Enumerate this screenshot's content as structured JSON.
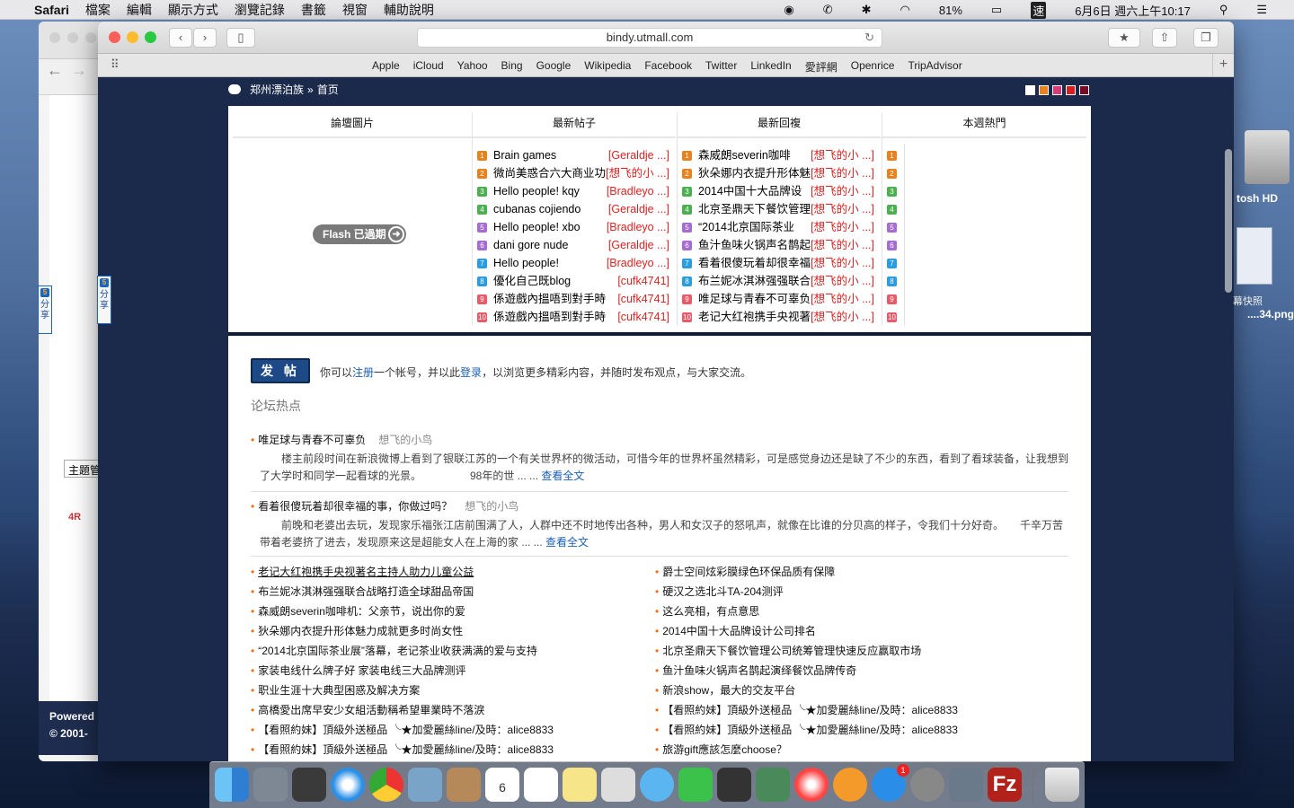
{
  "menubar": {
    "app": "Safari",
    "items": [
      "檔案",
      "編輯",
      "顯示方式",
      "瀏覽記錄",
      "書籤",
      "視窗",
      "輔助說明"
    ],
    "battery": "81%",
    "input": "速",
    "clock": "6月6日 週六上午10:17"
  },
  "back_window": {
    "topic": "主題管",
    "powered": "Powered",
    "copyright": "© 2001-"
  },
  "browser": {
    "url": "bindy.utmall.com",
    "favorites": [
      "Apple",
      "iCloud",
      "Yahoo",
      "Bing",
      "Google",
      "Wikipedia",
      "Facebook",
      "Twitter",
      "LinkedIn",
      "愛評網",
      "Openrice",
      "TripAdvisor"
    ]
  },
  "page": {
    "breadcrumb": {
      "forum": "郑州漂泊族",
      "sep": "»",
      "home": "首页"
    },
    "swatch_colors": [
      "#ffffff",
      "#e8821e",
      "#d83a7a",
      "#d62020",
      "#7a0a2a"
    ],
    "columns": {
      "pics": "論壇圖片",
      "new_posts": "最新帖子",
      "new_replies": "最新回複",
      "weekly_hot": "本週熱門"
    },
    "flash_label": "Flash 已過期",
    "badge_colors": [
      "#e8821e",
      "#e8821e",
      "#4caf50",
      "#4caf50",
      "#a66cd0",
      "#a66cd0",
      "#2a9de0",
      "#2a9de0",
      "#e85a6a",
      "#e85a6a"
    ],
    "new_posts": [
      {
        "title": "Brain games",
        "author": "[Geraldje ...]"
      },
      {
        "title": "微尚美惑合六大商业功",
        "author": "[想飞的小 ...]"
      },
      {
        "title": "Hello people! kqy",
        "author": "[Bradleyo ...]"
      },
      {
        "title": "cubanas cojiendo",
        "author": "[Geraldje ...]"
      },
      {
        "title": "Hello people! xbo",
        "author": "[Bradleyo ...]"
      },
      {
        "title": "dani gore nude",
        "author": "[Geraldje ...]"
      },
      {
        "title": "Hello people!",
        "author": "[Bradleyo ...]"
      },
      {
        "title": "優化自己既blog",
        "author": "[cufk4741]"
      },
      {
        "title": "係遊戲內搵唔到對手時",
        "author": "[cufk4741]"
      },
      {
        "title": "係遊戲內搵唔到對手時",
        "author": "[cufk4741]"
      }
    ],
    "new_replies": [
      {
        "title": "森威朗severin咖啡",
        "author": "[想飞的小 ...]"
      },
      {
        "title": "狄朵娜内衣提升形体魅",
        "author": "[想飞的小 ...]"
      },
      {
        "title": "2014中国十大品牌设",
        "author": "[想飞的小 ...]"
      },
      {
        "title": "北京圣鼎天下餐饮管理",
        "author": "[想飞的小 ...]"
      },
      {
        "title": "“2014北京国际茶业",
        "author": "[想飞的小 ...]"
      },
      {
        "title": "鱼汁鱼味火锅声名鹊起",
        "author": "[想飞的小 ...]"
      },
      {
        "title": "看着很傻玩着却很幸福",
        "author": "[想飞的小 ...]"
      },
      {
        "title": "布兰妮冰淇淋强强联合",
        "author": "[想飞的小 ...]"
      },
      {
        "title": "唯足球与青春不可辜负",
        "author": "[想飞的小 ...]"
      },
      {
        "title": "老记大红袍携手央视著",
        "author": "[想飞的小 ...]"
      }
    ],
    "post_button": "发 帖",
    "intro": {
      "p1": "你可以",
      "register": "注册",
      "p2": "一个帐号，并以此",
      "login": "登录",
      "p3": "，以浏览更多精彩内容，并随时发布观点，与大家交流。"
    },
    "hot_title": "论坛热点",
    "articles": [
      {
        "title": "唯足球与青春不可辜负",
        "author": "想飞的小鸟",
        "body": "楼主前段时间在新浪微博上看到了银联江苏的一个有关世界杯的微活动，可惜今年的世界杯虽然精彩，可是感觉身边还是缺了不少的东西，看到了看球装备，让我想到了大学时和同学一起看球的光景。　　　　　98年的世 ... ...",
        "more": "查看全文"
      },
      {
        "title": "看着很傻玩着却很幸福的事，你做过吗？",
        "author": "想飞的小鸟",
        "body": "前晚和老婆出去玩，发现家乐福张江店前围满了人，人群中还不时地传出各种，男人和女汉子的怒吼声，就像在比谁的分贝高的样子，令我们十分好奇。　　千辛万苦带着老婆挤了进去，发现原来这是超能女人在上海的家 ... ...",
        "more": "查看全文"
      }
    ],
    "links_left": [
      "老记大红袍携手央视著名主持人助力儿童公益",
      "布兰妮冰淇淋强强联合战略打造全球甜品帝国",
      "森威朗severin咖啡机：父亲节，说出你的爱",
      "狄朵娜内衣提升形体魅力成就更多时尚女性",
      "“2014北京国际茶业展”落幕，老记茶业收获满满的爱与支持",
      "家装电线什么牌子好 家装电线三大品牌测评",
      "职业生涯十大典型困惑及解决方案",
      "高橋愛出席早安少女組活動稱希望畢業時不落淚",
      "【看照約妹】頂級外送極品 ╰★加愛麗絲line/及時：alice8833",
      "【看照約妹】頂級外送極品 ╰★加愛麗絲line/及時：alice8833"
    ],
    "links_right": [
      "爵士空间炫彩膜绿色环保品质有保障",
      "硬汉之选北斗TA-204测评",
      "这么亮相，有点意思",
      "2014中国十大品牌设计公司排名",
      "北京圣鼎天下餐饮管理公司统筹管理快速反应赢取市场",
      "鱼汁鱼味火锅声名鹊起演绎餐饮品牌传奇",
      "新浪show，最大的交友平台",
      "【看照約妹】頂級外送極品 ╰★加愛麗絲line/及時：alice8833",
      "【看照約妹】頂級外送極品 ╰★加愛麗絲line/及時：alice8833",
      "旅游gift應該怎麼choose？"
    ],
    "share_label": "分享",
    "share_icon": "5"
  },
  "desktop": {
    "hd_label": "tosh HD",
    "thumb_l1": "幕快照",
    "thumb_l2": "....34.png"
  },
  "dock": {
    "calendar_day": "6",
    "calendar_month": "6月",
    "appstore_badge": "1"
  }
}
